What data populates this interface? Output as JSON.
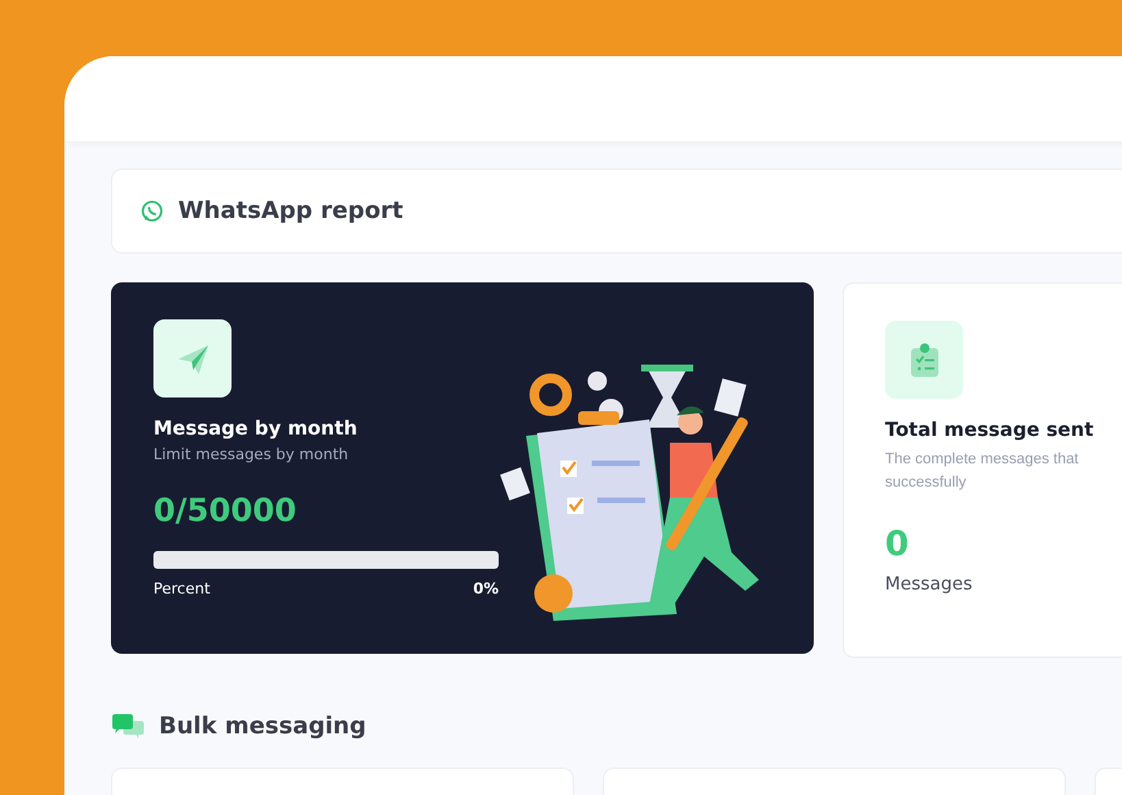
{
  "report": {
    "title": "WhatsApp report"
  },
  "month_card": {
    "title": "Message by month",
    "subtitle": "Limit messages by month",
    "count": "0/50000",
    "progress": {
      "level": 0,
      "label": "Percent",
      "reading": "0%"
    }
  },
  "sent_card": {
    "title": "Total message sent",
    "subtitle": "The complete messages that successfully",
    "count": "0",
    "unit": "Messages"
  },
  "bulk": {
    "title": "Bulk messaging"
  }
}
